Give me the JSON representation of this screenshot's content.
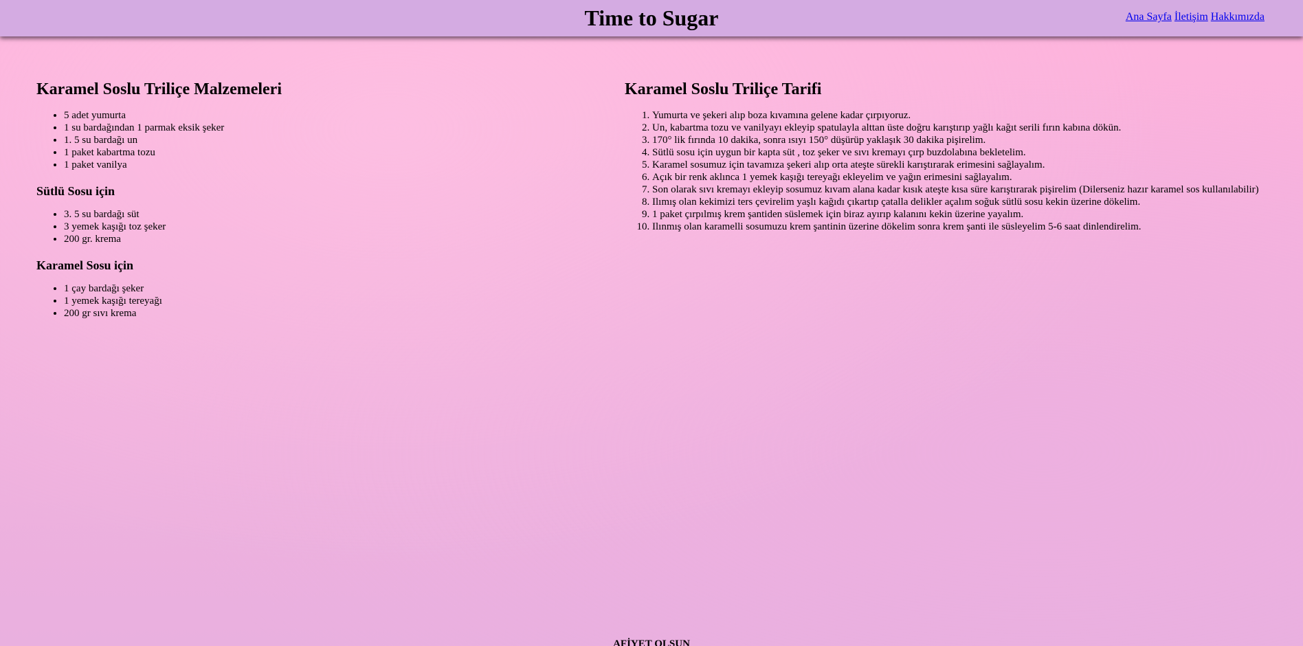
{
  "header": {
    "title": "Time to Sugar",
    "nav": [
      "Ana Sayfa",
      "İletişim",
      "Hakkımızda"
    ]
  },
  "ingredients": {
    "title": "Karamel Soslu Triliçe Malzemeleri",
    "main_items": [
      "5 adet yumurta",
      "1 su bardağından 1 parmak eksik şeker",
      "1. 5 su bardağı un",
      "1 paket kabartma tozu",
      "1 paket vanilya"
    ],
    "milk_sauce_title": "Sütlü Sosu için",
    "milk_sauce_items": [
      "3. 5 su bardağı süt",
      "3 yemek kaşığı toz şeker",
      "200 gr. krema"
    ],
    "caramel_sauce_title": "Karamel Sosu için",
    "caramel_sauce_items": [
      "1 çay bardağı şeker",
      "1 yemek kaşığı tereyağı",
      "200 gr sıvı krema"
    ]
  },
  "recipe": {
    "title": "Karamel Soslu Triliçe Tarifi",
    "steps": [
      "Yumurta ve şekeri alıp boza kıvamına gelene kadar çırpıyoruz.",
      "Un, kabartma tozu ve vanilyayı ekleyip spatulayla alttan üste doğru karıştırıp yağlı kağıt serili fırın kabına dökün.",
      "170° lik fırında 10 dakika, sonra ısıyı 150° düşürüp yaklaşık 30 dakika pişirelim.",
      "Sütlü sosu için uygun bir kapta süt , toz şeker ve sıvı kremayı çırp buzdolabına bekletelim.",
      "Karamel sosumuz için tavamıza şekeri alıp orta ateşte sürekli karıştırarak erimesini sağlayalım.",
      "Açık bir renk aklınca 1 yemek kaşığı tereyağı ekleyelim ve yağın erimesini sağlayalım.",
      "Son olarak sıvı kremayı ekleyip sosumuz kıvam alana kadar kısık ateşte kısa süre karıştırarak pişirelim (Dilerseniz hazır karamel sos kullanılabilir)",
      "Ilımış olan kekimizi ters çevirelim yaşlı kağıdı çıkartıp çatalla delikler açalım soğuk sütlü sosu kekin üzerine dökelim.",
      "1 paket çırpılmış krem şantiden süslemek için biraz ayırıp kalanını kekin üzerine yayalım.",
      "Ilınmış olan karamelli sosumuzu krem şantinin üzerine dökelim sonra krem şanti ile süsleyelim 5-6 saat dinlendirelim."
    ]
  },
  "footer": {
    "text": "AFİYET OLSUN"
  }
}
